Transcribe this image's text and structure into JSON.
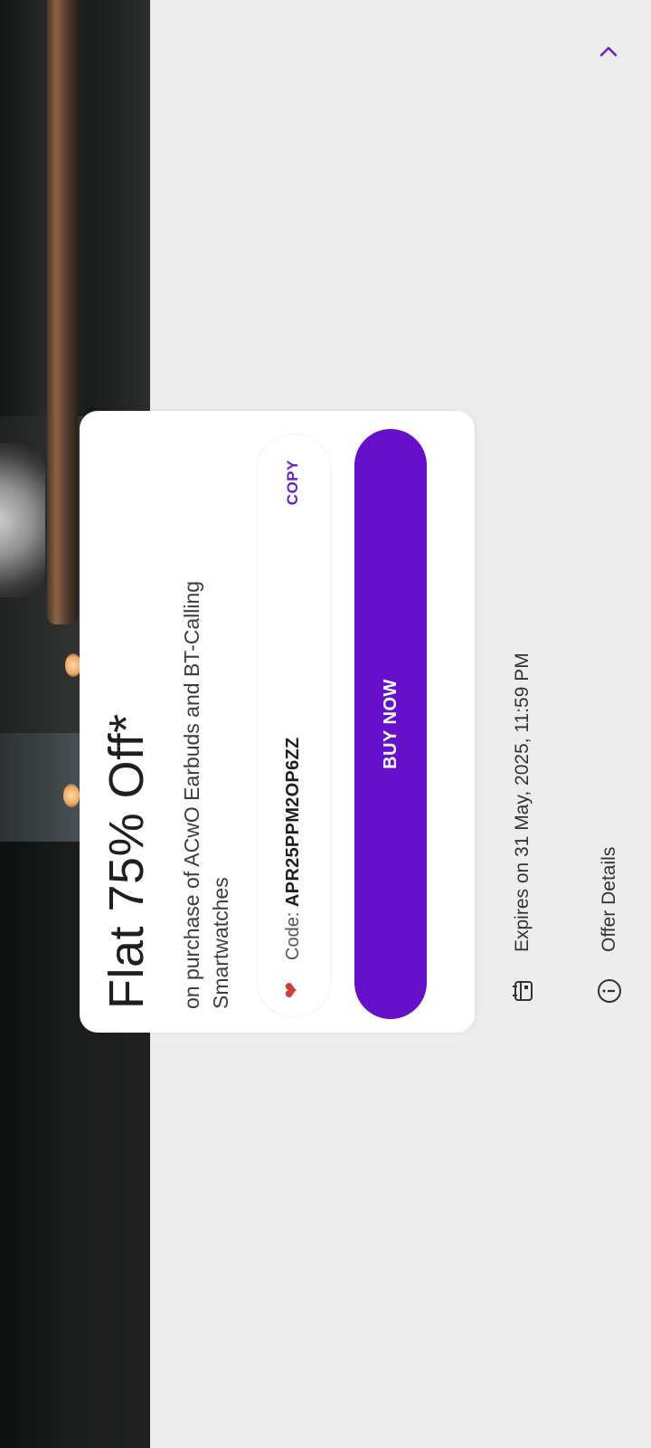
{
  "offer": {
    "title": "Flat 75% Off*",
    "subtitle": "on purchase of ACwO Earbuds and BT-Calling Smartwatches",
    "code_label": "Code:",
    "code_value": "APR25PPM2OP6ZZ",
    "copy_label": "COPY",
    "buy_label": "BUY NOW"
  },
  "expiry": {
    "icon": "calendar-icon",
    "text": "Expires on 31 May, 2025, 11:59 PM"
  },
  "details": {
    "icon": "info-icon",
    "label": "Offer Details",
    "chevron": "chevron-right-icon"
  },
  "colors": {
    "accent": "#6610cc",
    "copy": "#6a1fd0",
    "heart": "#d23d3d",
    "background": "#ededed",
    "card": "#ffffff"
  }
}
